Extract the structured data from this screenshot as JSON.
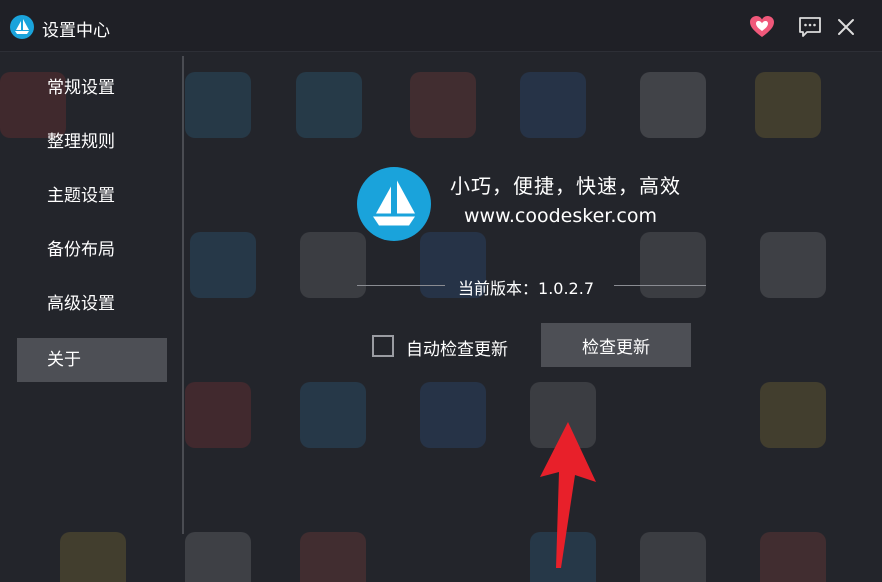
{
  "window": {
    "title": "设置中心",
    "logo_icon": "sailboat-icon",
    "favorite_icon": "heart-icon",
    "feedback_icon": "chat-icon",
    "close_icon": "close-icon"
  },
  "sidebar": {
    "items": [
      {
        "label": "常规设置",
        "active": false
      },
      {
        "label": "整理规则",
        "active": false
      },
      {
        "label": "主题设置",
        "active": false
      },
      {
        "label": "备份布局",
        "active": false
      },
      {
        "label": "高级设置",
        "active": false
      },
      {
        "label": "关于",
        "active": true
      }
    ]
  },
  "about": {
    "slogan": "小巧，便捷，快速，高效",
    "website": "www.coodesker.com",
    "version_label": "当前版本：",
    "version_value": "1.0.2.7",
    "auto_update_label": "自动检查更新",
    "auto_update_checked": false,
    "check_update_button": "检查更新"
  },
  "colors": {
    "accent": "#1aa3db",
    "heart": "#f0587a",
    "annotation_arrow": "#e8202a",
    "active_item": "#4d4f55"
  }
}
